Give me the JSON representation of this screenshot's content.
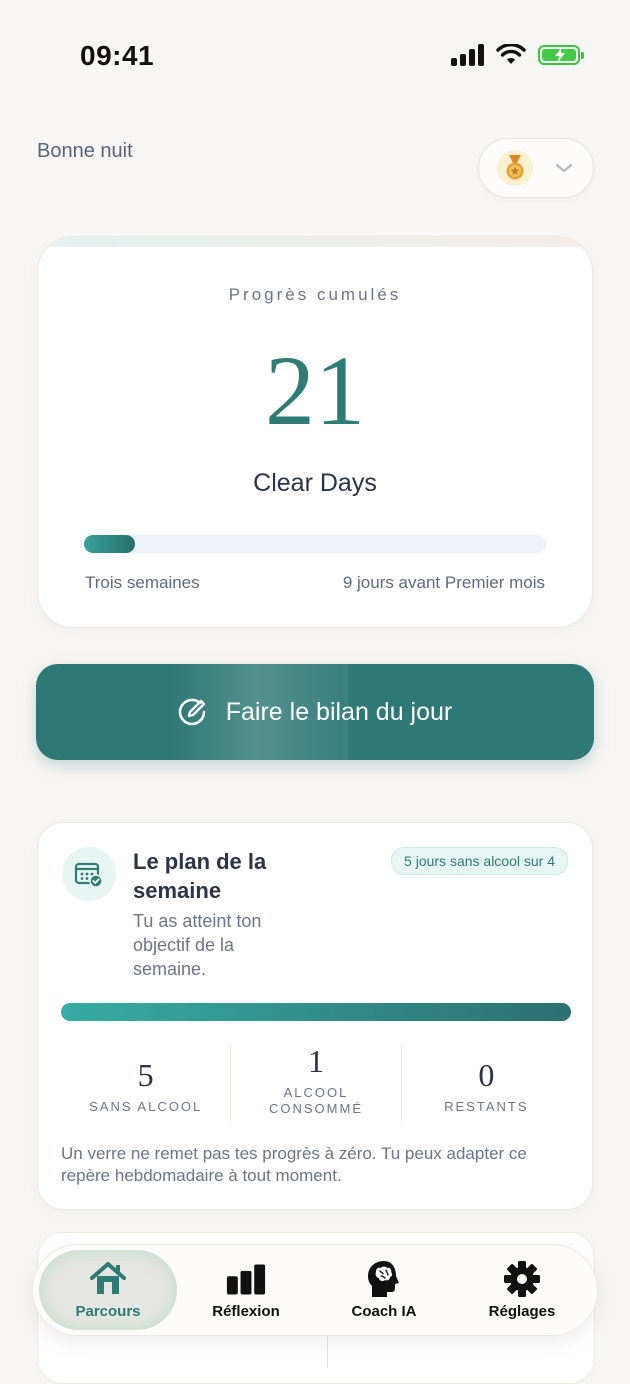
{
  "status_bar": {
    "time": "09:41"
  },
  "header": {
    "greeting": "Bonne nuit",
    "badge_icon": "medal-icon"
  },
  "progress_card": {
    "title": "Progrès cumulés",
    "count": "21",
    "unit": "Clear Days",
    "progress_fraction": 0.11,
    "milestone_current": "Trois semaines",
    "milestone_next": "9 jours avant Premier mois"
  },
  "checkin_button": {
    "label": "Faire le bilan du jour"
  },
  "weekly_plan": {
    "title": "Le plan de la semaine",
    "subtitle": "Tu as atteint ton objectif de la semaine.",
    "pill": "5 jours sans alcool sur 4",
    "progress_fraction": 1.0,
    "stats": [
      {
        "value": "5",
        "label": "SANS ALCOOL"
      },
      {
        "value": "1",
        "label": "ALCOOL CONSOMMÉ"
      },
      {
        "value": "0",
        "label": "RESTANTS"
      }
    ],
    "note": "Un verre ne remet pas tes progrès à zéro. Tu peux adapter ce repère hebdomadaire à tout moment."
  },
  "tabs": [
    {
      "label": "Parcours",
      "icon": "home-icon",
      "active": true
    },
    {
      "label": "Réflexion",
      "icon": "bar-chart-icon",
      "active": false
    },
    {
      "label": "Coach IA",
      "icon": "brain-head-icon",
      "active": false
    },
    {
      "label": "Réglages",
      "icon": "gear-icon",
      "active": false
    }
  ],
  "colors": {
    "accent": "#2e7876",
    "background": "#f8f6f4",
    "text": "#2b3446",
    "muted": "#6b7488"
  }
}
